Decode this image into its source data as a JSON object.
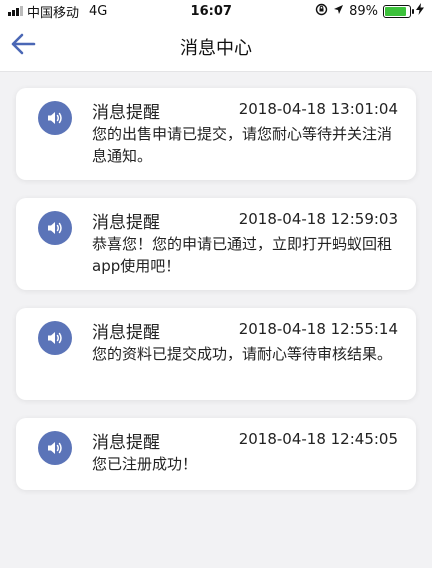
{
  "status_bar": {
    "carrier": "中国移动",
    "network": "4G",
    "time": "16:07",
    "battery_percent": "89%",
    "battery_level": 0.89,
    "battery_color": "#3cc13b"
  },
  "nav": {
    "back_icon": "back-arrow-icon",
    "title": "消息中心",
    "accent": "#4a67b5"
  },
  "messages": [
    {
      "title": "消息提醒",
      "time": "2018-04-18 13:01:04",
      "text": "您的出售申请已提交，请您耐心等待并关注消息通知。",
      "icon": "speaker-icon"
    },
    {
      "title": "消息提醒",
      "time": "2018-04-18 12:59:03",
      "text": "恭喜您！您的申请已通过，立即打开蚂蚁回租app使用吧！",
      "icon": "speaker-icon"
    },
    {
      "title": "消息提醒",
      "time": "2018-04-18 12:55:14",
      "text": "您的资料已提交成功，请耐心等待审核结果。",
      "icon": "speaker-icon"
    },
    {
      "title": "消息提醒",
      "time": "2018-04-18 12:45:05",
      "text": "您已注册成功！",
      "icon": "speaker-icon"
    }
  ],
  "icon_color": "#5b74b8"
}
